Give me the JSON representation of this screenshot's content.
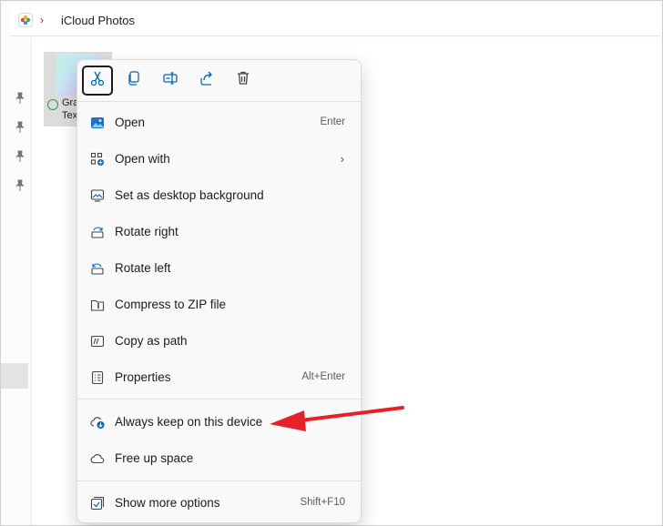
{
  "address_bar": {
    "path_label": "iCloud Photos"
  },
  "file": {
    "name_line1": "Gra",
    "name_line2": "Tex"
  },
  "context_menu": {
    "toolbar": [
      {
        "id": "cut",
        "icon": "scissors-icon"
      },
      {
        "id": "copy",
        "icon": "copy-icon"
      },
      {
        "id": "rename",
        "icon": "rename-icon"
      },
      {
        "id": "share",
        "icon": "share-icon"
      },
      {
        "id": "delete",
        "icon": "trash-icon"
      }
    ],
    "items": [
      {
        "label": "Open",
        "shortcut": "Enter",
        "icon": "image-icon"
      },
      {
        "label": "Open with",
        "shortcut": "",
        "icon": "open-with-icon",
        "submenu": true
      },
      {
        "label": "Set as desktop background",
        "shortcut": "",
        "icon": "desktop-background-icon"
      },
      {
        "label": "Rotate right",
        "shortcut": "",
        "icon": "rotate-right-icon"
      },
      {
        "label": "Rotate left",
        "shortcut": "",
        "icon": "rotate-left-icon"
      },
      {
        "label": "Compress to ZIP file",
        "shortcut": "",
        "icon": "zip-folder-icon"
      },
      {
        "label": "Copy as path",
        "shortcut": "",
        "icon": "copy-path-icon"
      },
      {
        "label": "Properties",
        "shortcut": "Alt+Enter",
        "icon": "properties-icon"
      },
      {
        "label": "Always keep on this device",
        "shortcut": "",
        "icon": "cloud-download-icon"
      },
      {
        "label": "Free up space",
        "shortcut": "",
        "icon": "cloud-icon"
      },
      {
        "label": "Show more options",
        "shortcut": "Shift+F10",
        "icon": "more-options-icon"
      }
    ],
    "submenu_glyph": "›"
  },
  "annotation": {
    "arrow_color": "#e8202a"
  },
  "colors": {
    "accent": "#0067c0",
    "focus_border": "#1b1b1b"
  }
}
